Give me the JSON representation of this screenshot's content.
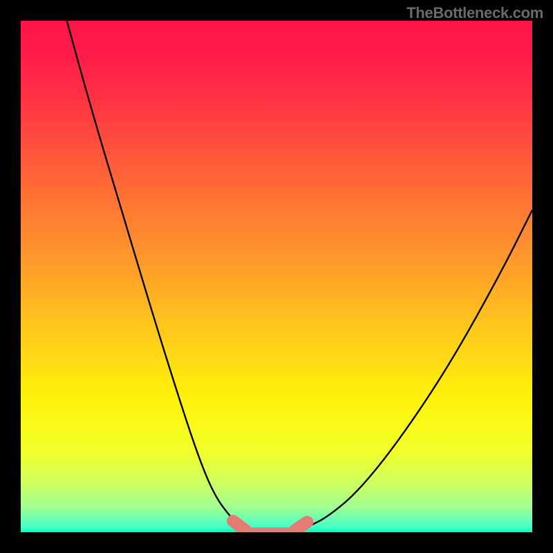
{
  "watermark": "TheBottleneck.com",
  "colors": {
    "frame": "#000000",
    "curve": "#000000",
    "marker": "#e57c72",
    "gradient_top": "#ff1448",
    "gradient_bottom": "#00ffb0"
  },
  "chart_data": {
    "type": "line",
    "title": "",
    "xlabel": "",
    "ylabel": "",
    "xlim": [
      0,
      100
    ],
    "ylim": [
      0,
      100
    ],
    "grid": false,
    "legend": false,
    "note": "Axes are ratio scales with no tick labels; values are read as percentages of the plot area (0=left/bottom, 100=right/top).",
    "series": [
      {
        "name": "left-branch",
        "x": [
          9,
          14,
          20,
          26,
          31,
          35,
          38,
          41,
          43
        ],
        "y": [
          100,
          82,
          62,
          42,
          26,
          14,
          7,
          3,
          1
        ]
      },
      {
        "name": "trough",
        "x": [
          43,
          47,
          52,
          56
        ],
        "y": [
          1,
          0,
          0,
          1
        ]
      },
      {
        "name": "right-branch",
        "x": [
          56,
          60,
          66,
          74,
          84,
          94,
          100
        ],
        "y": [
          1,
          3,
          8,
          18,
          33,
          51,
          63
        ]
      }
    ],
    "markers": [
      {
        "name": "trough-left-pill",
        "x0": 41.5,
        "y0": 2.2,
        "x1": 44.0,
        "y1": 0.3
      },
      {
        "name": "trough-right-pill",
        "x0": 53.5,
        "y0": 0.3,
        "x1": 56.0,
        "y1": 2.0
      },
      {
        "name": "trough-center-bar",
        "x0": 43.5,
        "y0": 0.0,
        "x1": 54.0,
        "y1": 0.0
      }
    ]
  }
}
